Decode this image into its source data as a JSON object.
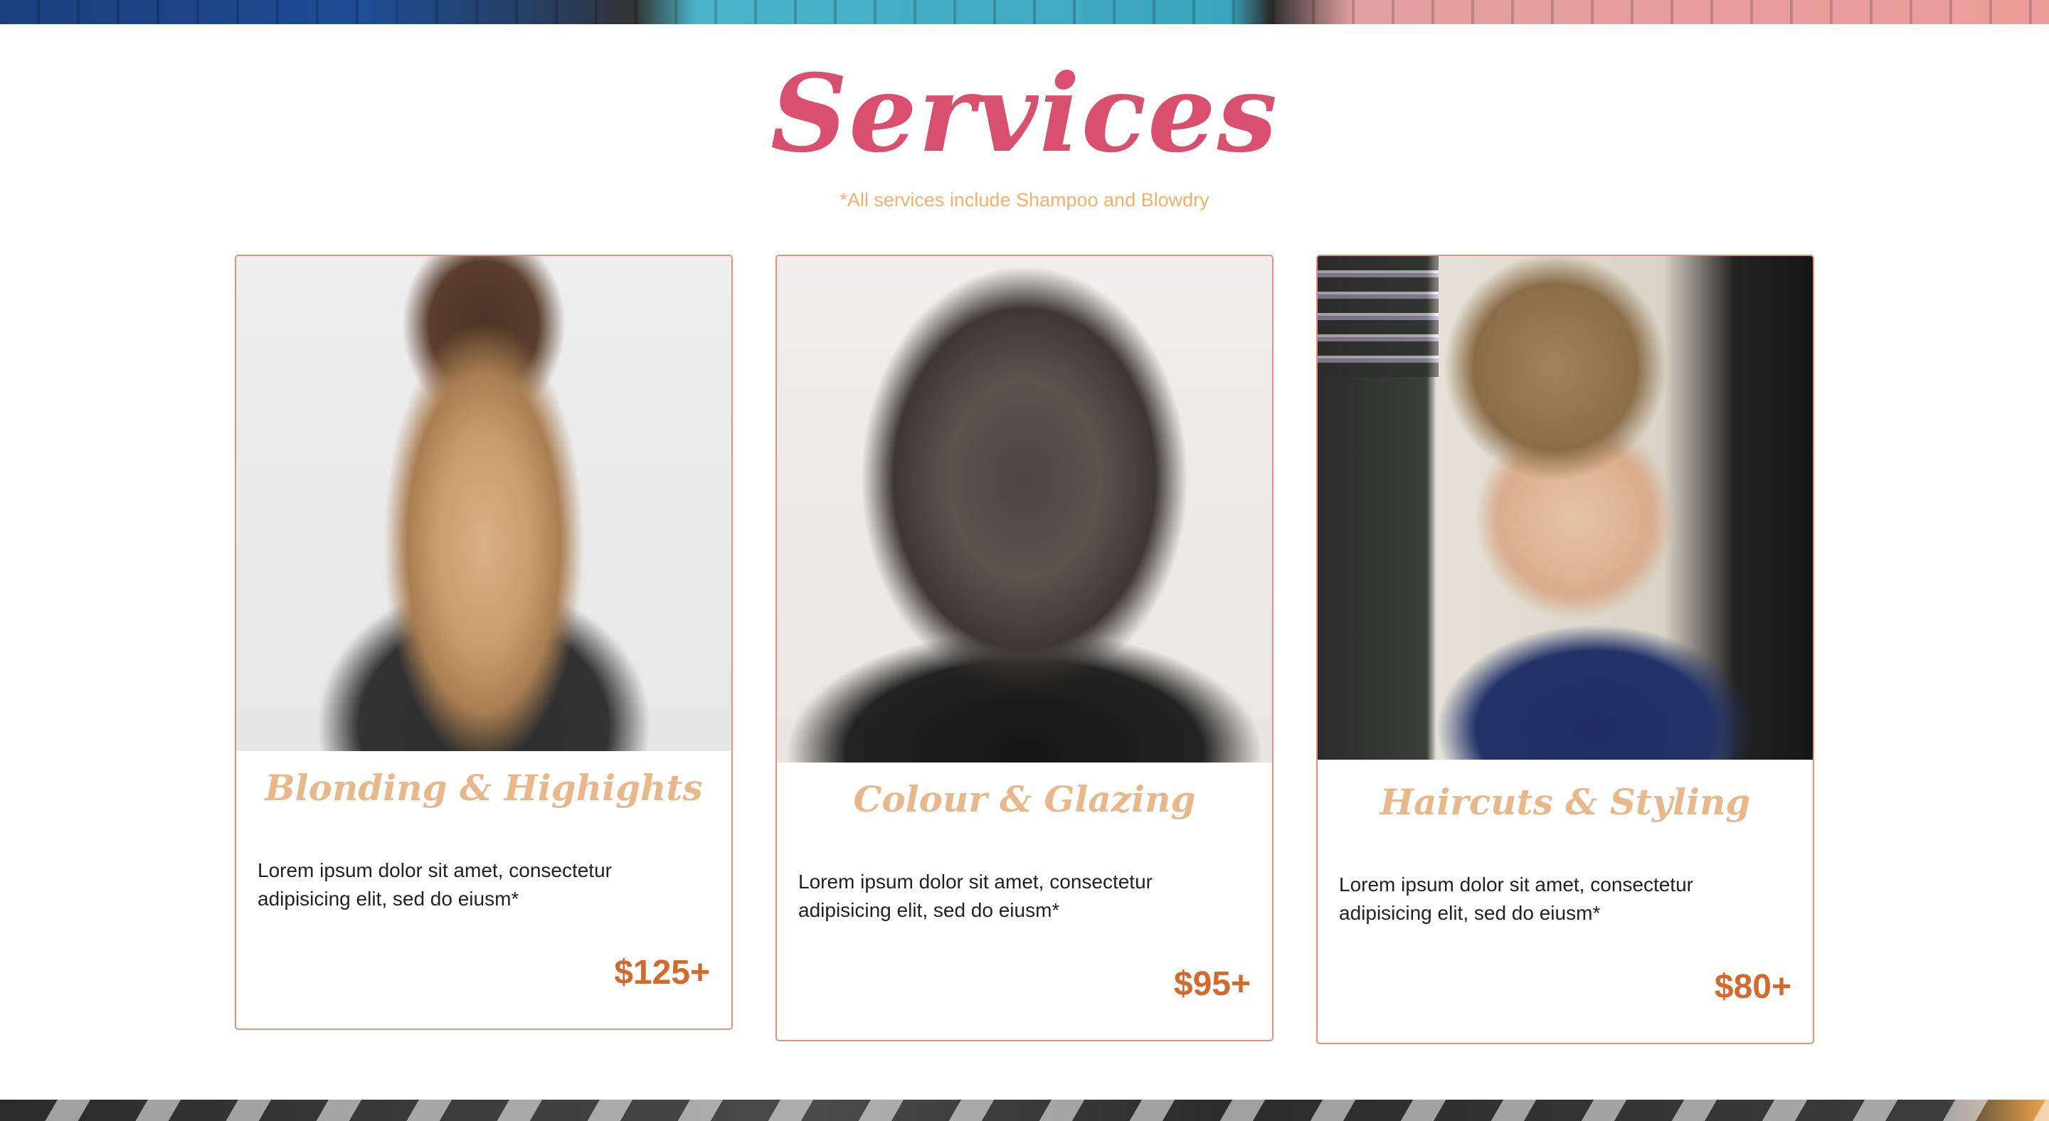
{
  "section": {
    "title": "Services",
    "note": "*All services include Shampoo and Blowdry"
  },
  "cards": [
    {
      "title": "Blonding & Highights",
      "description": "Lorem ipsum dolor sit amet, consectetur adipisicing elit, sed do eiusm*",
      "price": "$125+"
    },
    {
      "title": "Colour & Glazing",
      "description": "Lorem ipsum dolor sit amet, consectetur adipisicing elit, sed do eiusm*",
      "price": "$95+"
    },
    {
      "title": "Haircuts & Styling",
      "description": "Lorem ipsum dolor sit amet, consectetur adipisicing elit, sed do eiusm*",
      "price": "$80+"
    }
  ],
  "colors": {
    "title": "#d9506f",
    "note": "#f2b06a",
    "card_title": "#e8b88a",
    "price": "#d2692e",
    "card_border": "#e2917a"
  }
}
